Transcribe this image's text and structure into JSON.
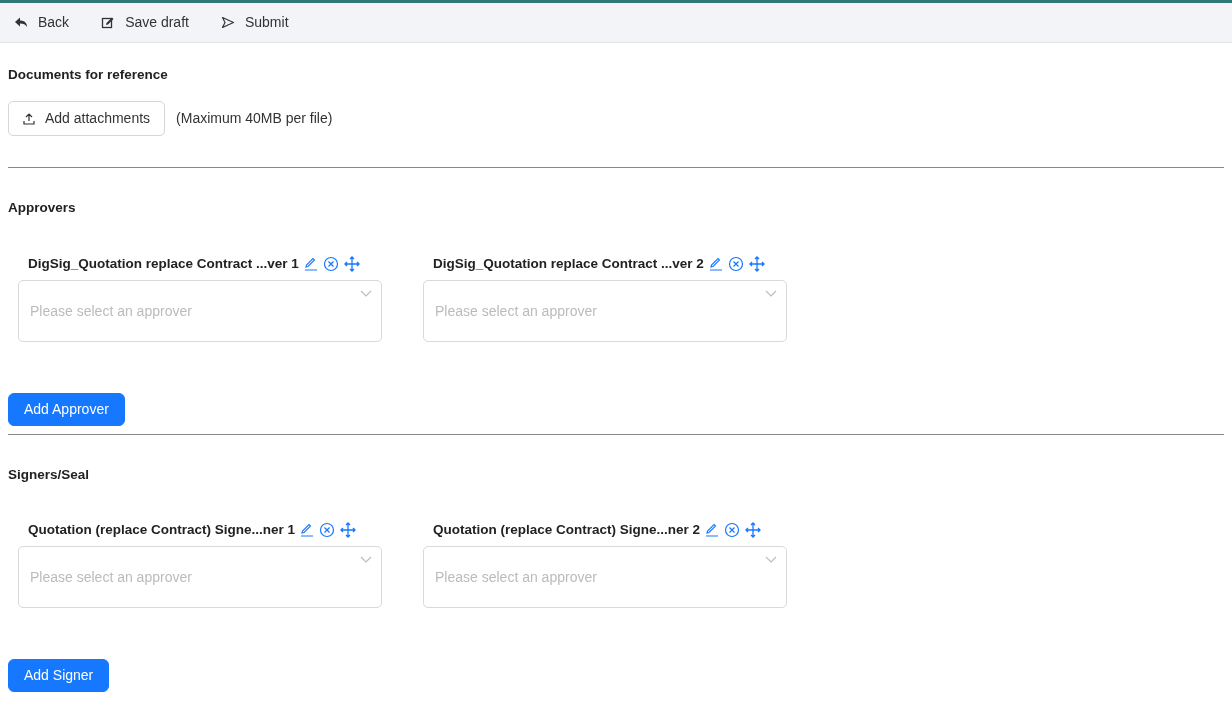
{
  "toolbar": [
    {
      "label": "Back",
      "kind": "back"
    },
    {
      "label": "Save draft",
      "kind": "edit"
    },
    {
      "label": "Submit",
      "kind": "send"
    }
  ],
  "documents": {
    "title": "Documents for reference",
    "button": "Add attachments",
    "note": "(Maximum 40MB per file)"
  },
  "groups": [
    {
      "title": "Approvers",
      "slots": [
        {
          "label": "DigSig_Quotation replace Contract ...ver 1",
          "placeholder": "Please select an approver"
        },
        {
          "label": "DigSig_Quotation replace Contract ...ver 2",
          "placeholder": "Please select an approver"
        }
      ],
      "button": "Add Approver"
    },
    {
      "title": "Signers/Seal",
      "slots": [
        {
          "label": "Quotation (replace Contract) Signe...ner 1",
          "placeholder": "Please select an approver"
        },
        {
          "label": "Quotation (replace Contract) Signe...ner 2",
          "placeholder": "Please select an approver"
        }
      ],
      "button": "Add Signer"
    }
  ]
}
